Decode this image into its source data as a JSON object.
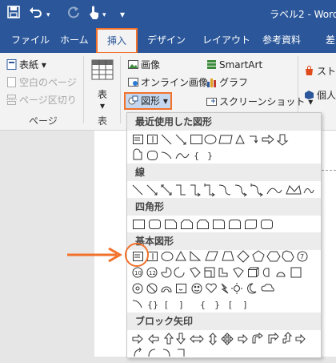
{
  "window": {
    "title": "ラベル2 - Word"
  },
  "quick_access": {
    "save_icon": "save-icon",
    "undo_icon": "undo-icon",
    "redo_icon": "redo-icon",
    "touch_icon": "touch-mode-icon",
    "customize_glyph": "▾"
  },
  "tabs": [
    {
      "label": "ファイル"
    },
    {
      "label": "ホーム"
    },
    {
      "label": "挿入",
      "active": true
    },
    {
      "label": "デザイン"
    },
    {
      "label": "レイアウト"
    },
    {
      "label": "参考資料"
    },
    {
      "label": "差"
    }
  ],
  "ribbon": {
    "pages_group": {
      "label": "ページ",
      "items": [
        "表紙",
        "空白のページ",
        "ページ区切り"
      ]
    },
    "table_group": {
      "label": "表",
      "button": "表"
    },
    "illustrations": {
      "picture": "画像",
      "online_picture": "オンライン画像",
      "shapes": "図形",
      "smartart": "SmartArt",
      "chart": "グラフ",
      "screenshot": "スクリーンショット"
    },
    "addins": {
      "store": "スト",
      "personal": "個人"
    }
  },
  "shapes_dropdown": {
    "sections": [
      "最近使用した図形",
      "線",
      "四角形",
      "基本図形",
      "ブロック矢印"
    ],
    "highlighted_shape": "text-box-shape"
  },
  "colors": {
    "accent": "#2b579a",
    "highlight": "#f2712b"
  }
}
